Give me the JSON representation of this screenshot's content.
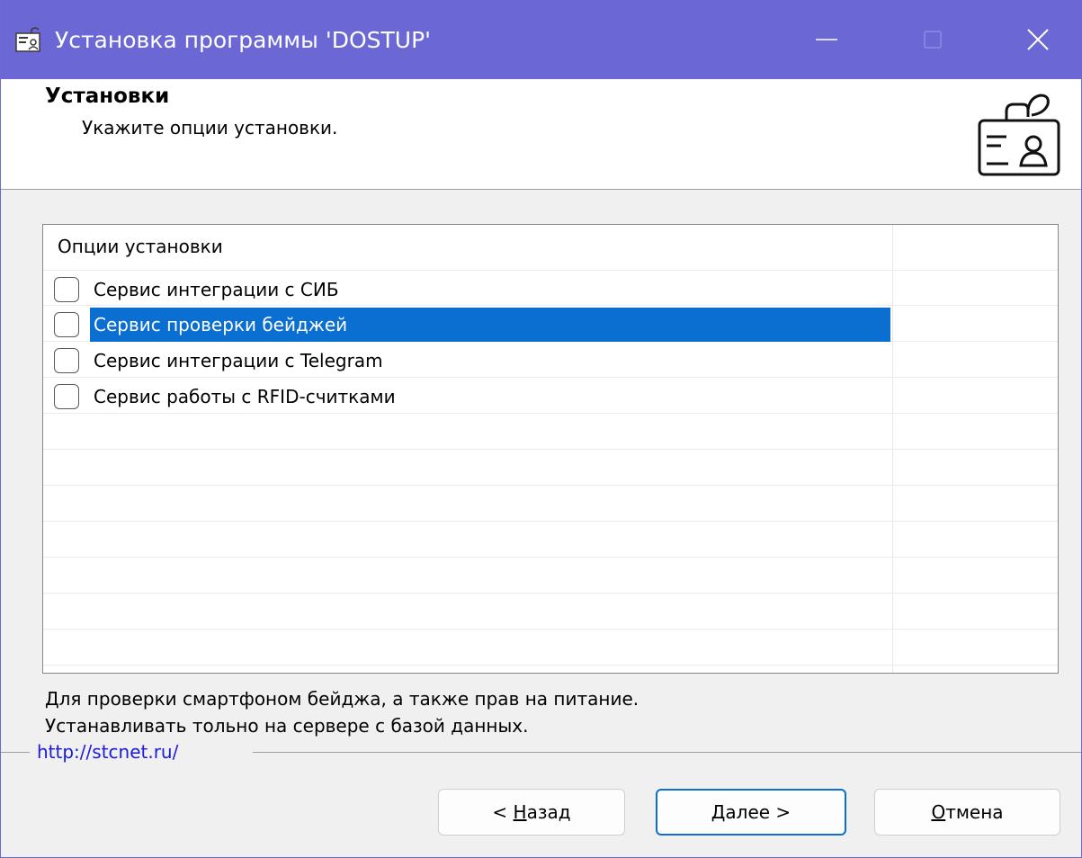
{
  "window": {
    "title": "Установка программы 'DOSTUP'"
  },
  "header": {
    "title": "Установки",
    "subtitle": "Укажите опции установки.",
    "icon": "badge-id-card-icon"
  },
  "options": {
    "column_header": "Опции установки",
    "items": [
      {
        "label": "Сервис интеграции с СИБ",
        "checked": false,
        "selected": false
      },
      {
        "label": "Сервис проверки бейджей",
        "checked": false,
        "selected": true
      },
      {
        "label": "Сервис интеграции с Telegram",
        "checked": false,
        "selected": false
      },
      {
        "label": "Сервис работы с RFID-считками",
        "checked": false,
        "selected": false
      }
    ]
  },
  "description": {
    "line1": "Для проверки смартфоном бейджа, а также прав на питание.",
    "line2": "Устанавливать тольно на сервере с базой данных."
  },
  "footer": {
    "link": "http://stcnet.ru/"
  },
  "buttons": {
    "back_prefix": "< ",
    "back_accel": "Н",
    "back_rest": "азад",
    "next_accel": "Д",
    "next_rest": "алее >",
    "cancel_accel": "О",
    "cancel_rest": "тмена"
  },
  "colors": {
    "titlebar": "#6b68d6",
    "selection": "#0a6fd1",
    "link": "#1a1adc"
  }
}
